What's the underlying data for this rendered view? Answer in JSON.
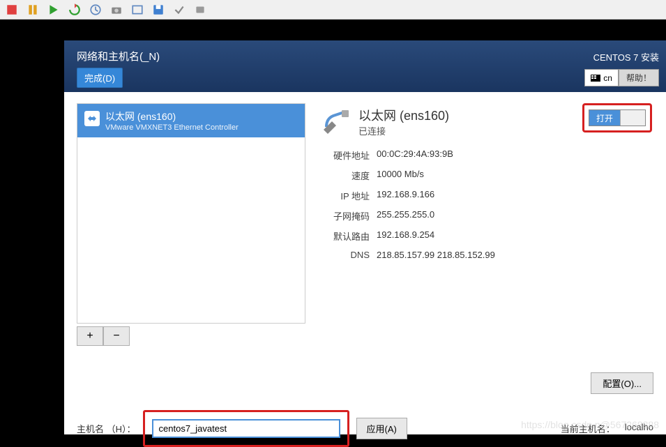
{
  "toolbar": {
    "icons": [
      "stop",
      "pause",
      "play",
      "refresh",
      "clock",
      "camera",
      "fit",
      "diskette",
      "check",
      "dev"
    ]
  },
  "header": {
    "title": "网络和主机名(_N)",
    "done_label": "完成(D)",
    "install_title": "CENTOS 7 安装",
    "lang": "cn",
    "help_label": "帮助！"
  },
  "network": {
    "item_name": "以太网 (ens160)",
    "item_sub": "VMware VMXNET3 Ethernet Controller",
    "add_label": "+",
    "remove_label": "−"
  },
  "detail": {
    "title": "以太网 (ens160)",
    "status": "已连接",
    "toggle_on": "打开",
    "props": [
      {
        "label": "硬件地址",
        "value": "00:0C:29:4A:93:9B"
      },
      {
        "label": "速度",
        "value": "10000 Mb/s"
      },
      {
        "label": "IP 地址",
        "value": "192.168.9.166"
      },
      {
        "label": "子网掩码",
        "value": "255.255.255.0"
      },
      {
        "label": "默认路由",
        "value": "192.168.9.254"
      },
      {
        "label": "DNS",
        "value": "218.85.157.99 218.85.152.99"
      }
    ],
    "config_label": "配置(O)..."
  },
  "hostname": {
    "label": "主机名 （H）：",
    "value": "centos7_javatest",
    "apply_label": "应用(A)",
    "current_label": "当前主机名：",
    "current_value": "localho"
  },
  "watermark": "https://blog.csdn.n@567268888"
}
